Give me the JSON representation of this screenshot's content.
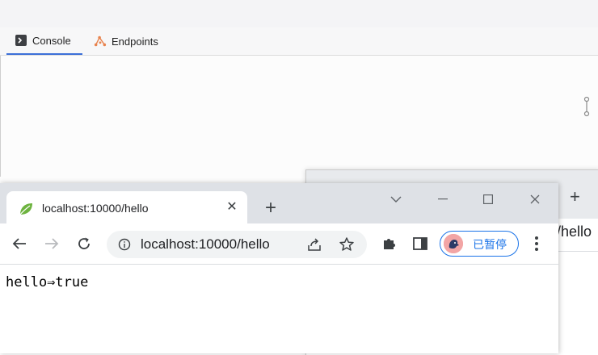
{
  "ide": {
    "tabs": [
      {
        "label": "Console",
        "icon": "console-icon"
      },
      {
        "label": "Endpoints",
        "icon": "endpoints-icon"
      }
    ]
  },
  "background_window": {
    "new_tab": "+",
    "url_fragment": "/hello"
  },
  "browser": {
    "tab": {
      "title": "localhost:10000/hello",
      "close": "✕"
    },
    "new_tab": "+",
    "address": {
      "url": "localhost:10000/hello"
    },
    "profile": {
      "label": "已暂停"
    },
    "page": {
      "content": "hello⇒true"
    },
    "colors": {
      "accent": "#1a73e8",
      "tabstrip": "#dee1e6"
    }
  }
}
